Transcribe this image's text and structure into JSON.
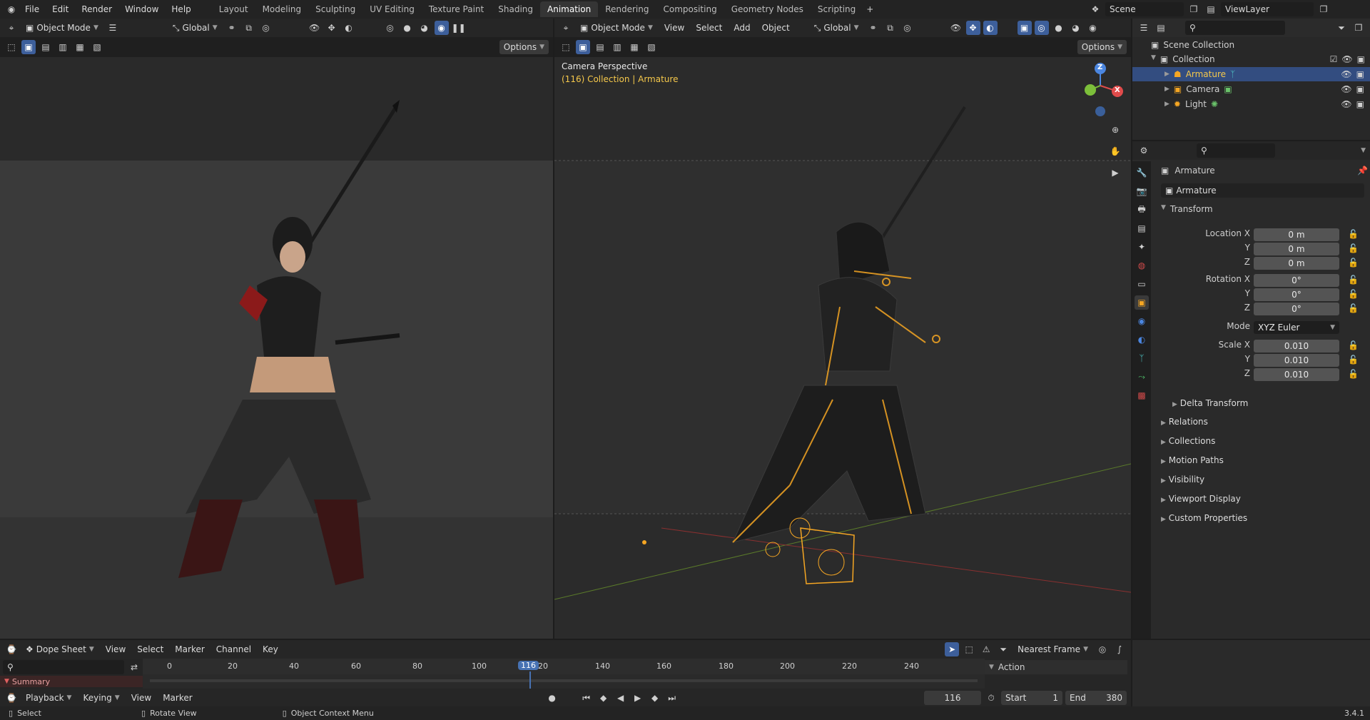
{
  "topbar": {
    "menus": [
      "File",
      "Edit",
      "Render",
      "Window",
      "Help"
    ],
    "workspaces": [
      "Layout",
      "Modeling",
      "Sculpting",
      "UV Editing",
      "Texture Paint",
      "Shading",
      "Animation",
      "Rendering",
      "Compositing",
      "Geometry Nodes",
      "Scripting"
    ],
    "active_workspace": "Animation",
    "scene": "Scene",
    "view_layer": "ViewLayer"
  },
  "left_viewport": {
    "mode": "Object Mode",
    "orientation": "Global",
    "options": "Options"
  },
  "right_viewport": {
    "mode": "Object Mode",
    "menus": [
      "View",
      "Select",
      "Add",
      "Object"
    ],
    "orientation": "Global",
    "options": "Options",
    "overlay_title": "Camera Perspective",
    "overlay_sub": "(116) Collection | Armature",
    "gizmo": {
      "z": "Z",
      "x": "X"
    }
  },
  "outliner": {
    "root": "Scene Collection",
    "collection": "Collection",
    "items": [
      {
        "label": "Armature",
        "selected": true
      },
      {
        "label": "Camera",
        "selected": false
      },
      {
        "label": "Light",
        "selected": false
      }
    ]
  },
  "properties": {
    "object_name": "Armature",
    "data_name": "Armature",
    "transform_label": "Transform",
    "location": {
      "label": "Location X",
      "x": "0 m",
      "y": "0 m",
      "z": "0 m"
    },
    "rotation": {
      "label": "Rotation X",
      "x": "0°",
      "y": "0°",
      "z": "0°"
    },
    "mode_label": "Mode",
    "mode_value": "XYZ Euler",
    "scale": {
      "label": "Scale X",
      "x": "0.010",
      "y": "0.010",
      "z": "0.010"
    },
    "axis_y": "Y",
    "axis_z": "Z",
    "subpanels": [
      "Delta Transform",
      "Relations",
      "Collections",
      "Motion Paths",
      "Visibility",
      "Viewport Display",
      "Custom Properties"
    ]
  },
  "dopesheet": {
    "editor": "Dope Sheet",
    "menus": [
      "View",
      "Select",
      "Marker",
      "Channel",
      "Key"
    ],
    "snap": "Nearest Frame",
    "ticks": [
      "0",
      "20",
      "40",
      "60",
      "80",
      "100",
      "120",
      "140",
      "160",
      "180",
      "200",
      "220",
      "240"
    ],
    "current_frame": "116",
    "summary": "Summary",
    "action": "Action"
  },
  "timeline": {
    "menus": [
      "Playback",
      "Keying",
      "View",
      "Marker"
    ],
    "frame": "116",
    "start_label": "Start",
    "start": "1",
    "end_label": "End",
    "end": "380"
  },
  "status": {
    "select": "Select",
    "rotate": "Rotate View",
    "context": "Object Context Menu",
    "version": "3.4.1"
  },
  "colors": {
    "accent": "#4772b3",
    "selected": "#f5a623",
    "bg": "#1d1d1d"
  }
}
